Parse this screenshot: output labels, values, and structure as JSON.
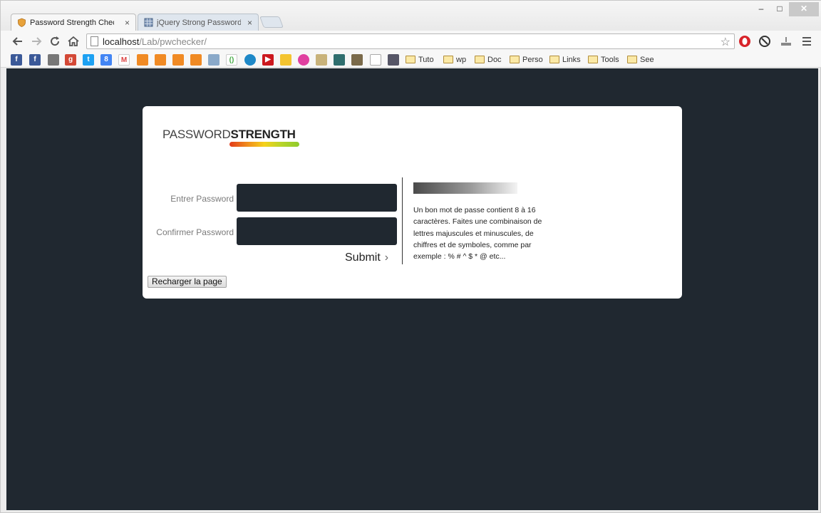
{
  "browser": {
    "tabs": [
      {
        "title": "Password Strength Check",
        "active": true
      },
      {
        "title": "jQuery Strong Password F",
        "active": false
      }
    ],
    "tab_close_symbol": "×",
    "window_controls": {
      "minimize": "–",
      "maximize": "□",
      "close": "✕"
    },
    "address_bar": {
      "host": "localhost",
      "path": "/Lab/pwchecker/"
    },
    "bookmarks": [
      {
        "label": "Tuto"
      },
      {
        "label": "wp"
      },
      {
        "label": "Doc"
      },
      {
        "label": "Perso"
      },
      {
        "label": "Links"
      },
      {
        "label": "Tools"
      },
      {
        "label": "See"
      }
    ]
  },
  "page": {
    "logo": {
      "light": "PASSWORD",
      "bold": "STRENGTH"
    },
    "form": {
      "password_label": "Entrer Password",
      "confirm_label": "Confirmer Password",
      "submit_label": "Submit"
    },
    "hint": "Un bon mot de passe contient 8 à 16 caractères. Faites une combinaison de lettres majuscules et minuscules, de chiffres et de symboles, comme par exemple : % # ^ $ * @ etc...",
    "reload_button": "Recharger la page"
  },
  "colors": {
    "page_background": "#202830",
    "card_background": "#ffffff",
    "input_background": "#202830"
  }
}
